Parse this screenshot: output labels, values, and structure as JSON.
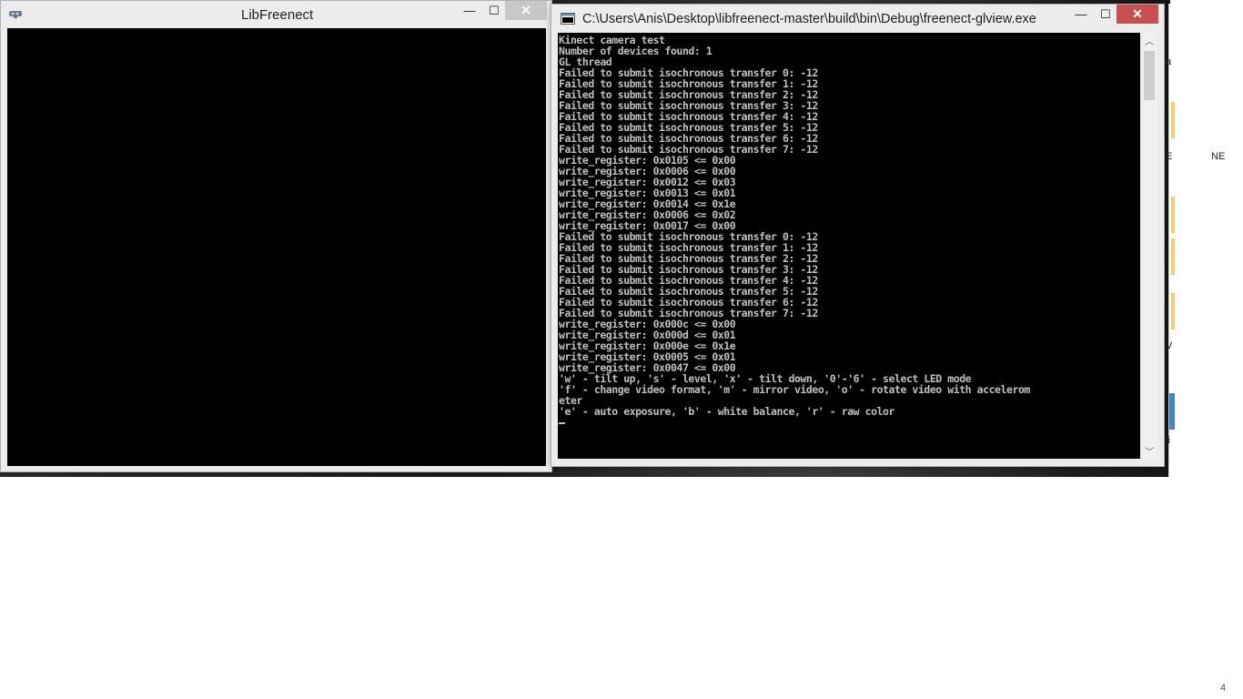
{
  "left_window": {
    "title": "LibFreenect",
    "controls": {
      "minimize": "—",
      "maximize": "☐",
      "close": "✕"
    }
  },
  "console_window": {
    "title": "C:\\Users\\Anis\\Desktop\\libfreenect-master\\build\\bin\\Debug\\freenect-glview.exe",
    "controls": {
      "minimize": "—",
      "maximize": "☐",
      "close": "✕"
    },
    "scroll": {
      "up": "︿",
      "down": "﹀"
    },
    "lines": [
      "Kinect camera test",
      "Number of devices found: 1",
      "GL thread",
      "Failed to submit isochronous transfer 0: -12",
      "Failed to submit isochronous transfer 1: -12",
      "Failed to submit isochronous transfer 2: -12",
      "Failed to submit isochronous transfer 3: -12",
      "Failed to submit isochronous transfer 4: -12",
      "Failed to submit isochronous transfer 5: -12",
      "Failed to submit isochronous transfer 6: -12",
      "Failed to submit isochronous transfer 7: -12",
      "write_register: 0x0105 <= 0x00",
      "write_register: 0x0006 <= 0x00",
      "write_register: 0x0012 <= 0x03",
      "write_register: 0x0013 <= 0x01",
      "write_register: 0x0014 <= 0x1e",
      "write_register: 0x0006 <= 0x02",
      "write_register: 0x0017 <= 0x00",
      "Failed to submit isochronous transfer 0: -12",
      "Failed to submit isochronous transfer 1: -12",
      "Failed to submit isochronous transfer 2: -12",
      "Failed to submit isochronous transfer 3: -12",
      "Failed to submit isochronous transfer 4: -12",
      "Failed to submit isochronous transfer 5: -12",
      "Failed to submit isochronous transfer 6: -12",
      "Failed to submit isochronous transfer 7: -12",
      "write_register: 0x000c <= 0x00",
      "write_register: 0x000d <= 0x01",
      "write_register: 0x000e <= 0x1e",
      "write_register: 0x0005 <= 0x01",
      "write_register: 0x0047 <= 0x00",
      "'w' - tilt up, 's' - level, 'x' - tilt down, '0'-'6' - select LED mode",
      "'f' - change video format, 'm' - mirror video, 'o' - rotate video with accelerom",
      "eter",
      "'e' - auto exposure, 'b' - white balance, 'r' - raw color"
    ]
  },
  "desktop": {
    "peek_labels": [
      "a",
      "E",
      "NE",
      "V",
      "li"
    ],
    "corner_text": "4"
  }
}
